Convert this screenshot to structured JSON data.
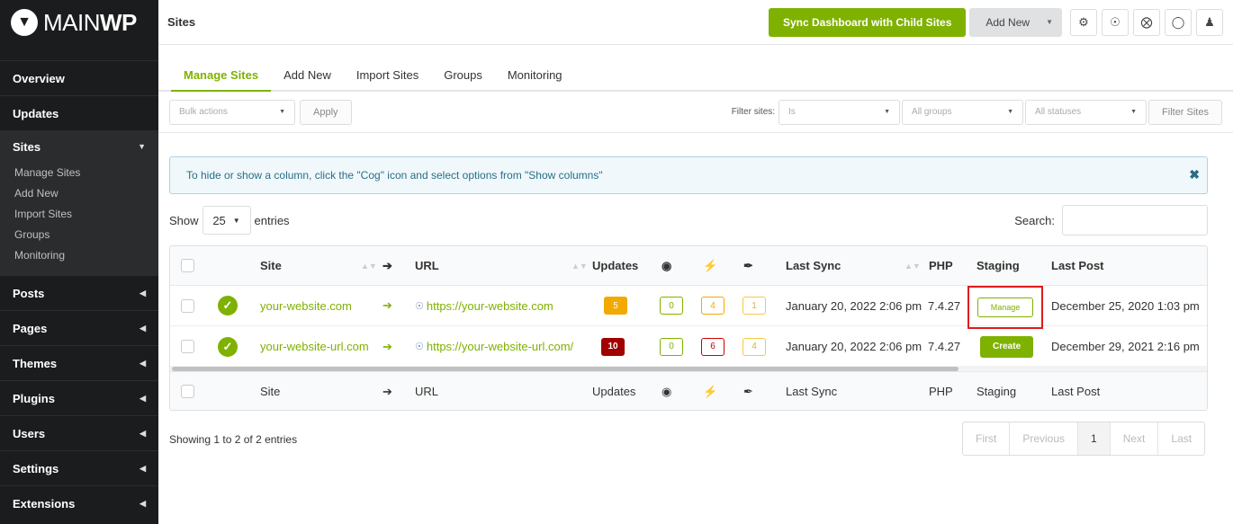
{
  "logo": {
    "brand_thin": "MAIN",
    "brand_bold": "WP"
  },
  "sidebar": {
    "items_top": [
      {
        "label": "Overview"
      },
      {
        "label": "Updates"
      }
    ],
    "sites": {
      "label": "Sites",
      "sub": [
        "Manage Sites",
        "Add New",
        "Import Sites",
        "Groups",
        "Monitoring"
      ]
    },
    "items_bottom": [
      {
        "label": "Posts"
      },
      {
        "label": "Pages"
      },
      {
        "label": "Themes"
      },
      {
        "label": "Plugins"
      },
      {
        "label": "Users"
      },
      {
        "label": "Settings"
      },
      {
        "label": "Extensions"
      }
    ]
  },
  "header": {
    "title": "Sites",
    "sync_label": "Sync Dashboard with Child Sites",
    "add_new_label": "Add New"
  },
  "tabs": [
    "Manage Sites",
    "Add New",
    "Import Sites",
    "Groups",
    "Monitoring"
  ],
  "filters": {
    "bulk_actions": "Bulk actions",
    "apply": "Apply",
    "filter_label": "Filter sites:",
    "is": "Is",
    "all_groups": "All groups",
    "all_statuses": "All statuses",
    "filter_button": "Filter Sites"
  },
  "info": {
    "message": "To hide or show a column, click the \"Cog\" icon and select options from \"Show columns\""
  },
  "table_controls": {
    "show": "Show",
    "length": "25",
    "entries": "entries",
    "search": "Search:"
  },
  "table": {
    "headers": {
      "site": "Site",
      "url": "URL",
      "updates": "Updates",
      "last_sync": "Last Sync",
      "php": "PHP",
      "staging": "Staging",
      "last_post": "Last Post"
    },
    "rows": [
      {
        "site": "your-website.com",
        "url": "https://your-website.com",
        "updates": "5",
        "wp": "0",
        "plugins": "4",
        "themes": "1",
        "last_sync": "January 20, 2022 2:06 pm",
        "php": "7.4.27",
        "staging": "Manage",
        "last_post": "December 25, 2020 1:03 pm"
      },
      {
        "site": "your-website-url.com",
        "url": "https://your-website-url.com/",
        "updates": "10",
        "wp": "0",
        "plugins": "6",
        "themes": "4",
        "last_sync": "January 20, 2022 2:06 pm",
        "php": "7.4.27",
        "staging": "Create",
        "last_post": "December 29, 2021 2:16 pm"
      }
    ]
  },
  "footer": {
    "showing": "Showing 1 to 2 of 2 entries",
    "pager": [
      "First",
      "Previous",
      "1",
      "Next",
      "Last"
    ]
  },
  "colors": {
    "accent": "#7fb100",
    "sidebar": "#1b1c1d",
    "danger": "#a00000",
    "warning": "#f2a900"
  }
}
